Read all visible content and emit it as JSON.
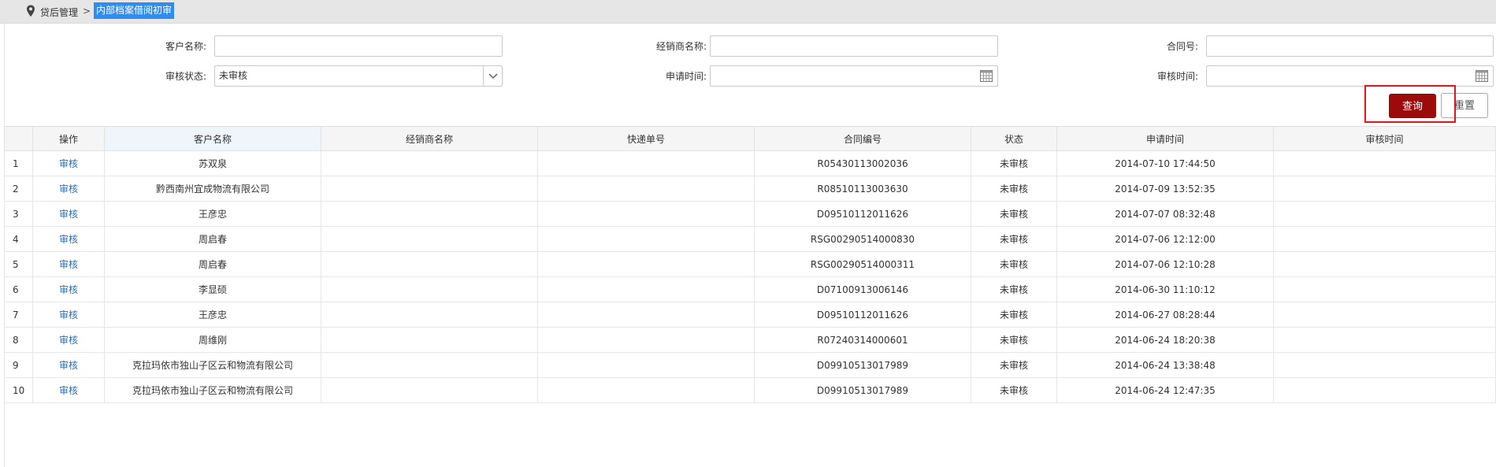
{
  "breadcrumb": {
    "home": "贷后管理",
    "separator": ">",
    "current": "内部档案借阅初审"
  },
  "filters": {
    "customer_label": "客户名称:",
    "dealer_label": "经销商名称:",
    "contract_label": "合同号:",
    "status_label": "审核状态:",
    "status_value": "未审核",
    "apply_time_label": "申请时间:",
    "review_time_label": "审核时间:"
  },
  "buttons": {
    "query": "查询",
    "reset": "重置"
  },
  "table": {
    "columns": [
      "操作",
      "客户名称",
      "经销商名称",
      "快递单号",
      "合同编号",
      "状态",
      "申请时间",
      "审核时间"
    ],
    "rows": [
      {
        "idx": "1",
        "action": "审核",
        "customer": "苏双泉",
        "dealer": "",
        "express": "",
        "contract": "R05430113002036",
        "status": "未审核",
        "apply_time": "2014-07-10 17:44:50",
        "review_time": ""
      },
      {
        "idx": "2",
        "action": "审核",
        "customer": "黔西南州宜成物流有限公司",
        "dealer": "",
        "express": "",
        "contract": "R08510113003630",
        "status": "未审核",
        "apply_time": "2014-07-09 13:52:35",
        "review_time": ""
      },
      {
        "idx": "3",
        "action": "审核",
        "customer": "王彦忠",
        "dealer": "",
        "express": "",
        "contract": "D09510112011626",
        "status": "未审核",
        "apply_time": "2014-07-07 08:32:48",
        "review_time": ""
      },
      {
        "idx": "4",
        "action": "审核",
        "customer": "周启春",
        "dealer": "",
        "express": "",
        "contract": "RSG00290514000830",
        "status": "未审核",
        "apply_time": "2014-07-06 12:12:00",
        "review_time": ""
      },
      {
        "idx": "5",
        "action": "审核",
        "customer": "周启春",
        "dealer": "",
        "express": "",
        "contract": "RSG00290514000311",
        "status": "未审核",
        "apply_time": "2014-07-06 12:10:28",
        "review_time": ""
      },
      {
        "idx": "6",
        "action": "审核",
        "customer": "李显硕",
        "dealer": "",
        "express": "",
        "contract": "D07100913006146",
        "status": "未审核",
        "apply_time": "2014-06-30 11:10:12",
        "review_time": ""
      },
      {
        "idx": "7",
        "action": "审核",
        "customer": "王彦忠",
        "dealer": "",
        "express": "",
        "contract": "D09510112011626",
        "status": "未审核",
        "apply_time": "2014-06-27 08:28:44",
        "review_time": ""
      },
      {
        "idx": "8",
        "action": "审核",
        "customer": "周维刚",
        "dealer": "",
        "express": "",
        "contract": "R07240314000601",
        "status": "未审核",
        "apply_time": "2014-06-24 18:20:38",
        "review_time": ""
      },
      {
        "idx": "9",
        "action": "审核",
        "customer": "克拉玛依市独山子区云和物流有限公司",
        "dealer": "",
        "express": "",
        "contract": "D09910513017989",
        "status": "未审核",
        "apply_time": "2014-06-24 13:38:48",
        "review_time": ""
      },
      {
        "idx": "10",
        "action": "审核",
        "customer": "克拉玛依市独山子区云和物流有限公司",
        "dealer": "",
        "express": "",
        "contract": "D09910513017989",
        "status": "未审核",
        "apply_time": "2014-06-24 12:47:35",
        "review_time": ""
      }
    ]
  },
  "colors": {
    "primary_button": "#9c0a0a",
    "highlight_border": "#e8141c",
    "breadcrumb_active_bg": "#2f8cf0",
    "link": "#2a6db5"
  }
}
